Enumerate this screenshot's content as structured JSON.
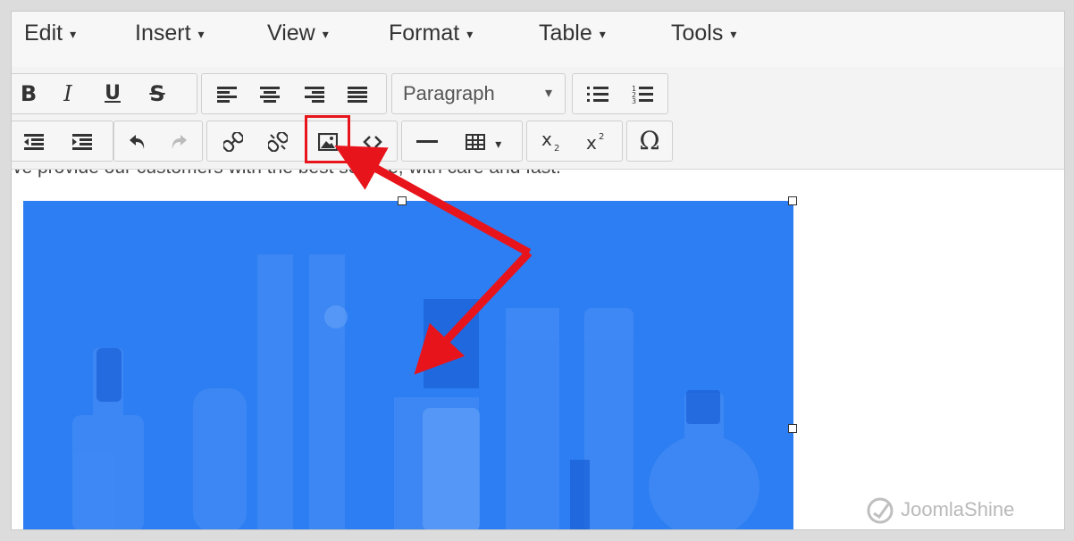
{
  "menubar": {
    "items": [
      {
        "label": "Edit"
      },
      {
        "label": "Insert"
      },
      {
        "label": "View"
      },
      {
        "label": "Format"
      },
      {
        "label": "Table"
      },
      {
        "label": "Tools"
      }
    ],
    "caret": "▾"
  },
  "toolbar": {
    "row1": {
      "bold": "B",
      "italic": "I",
      "underline": "U",
      "strikethrough": "S",
      "block_format": "Paragraph",
      "block_caret": "▾"
    },
    "row2": {
      "table_caret": "▾",
      "special_char": "Ω"
    },
    "icons": [
      "bold-icon",
      "italic-icon",
      "underline-icon",
      "strikethrough-icon",
      "align-left-icon",
      "align-center-icon",
      "align-right-icon",
      "align-justify-icon",
      "bullet-list-icon",
      "numbered-list-icon",
      "outdent-icon",
      "indent-icon",
      "undo-icon",
      "redo-icon",
      "link-icon",
      "unlink-icon",
      "insert-image-icon",
      "source-code-icon",
      "horizontal-rule-icon",
      "table-icon",
      "subscript-icon",
      "superscript-icon",
      "special-character-icon"
    ]
  },
  "content": {
    "body_text": "We provide our customers with the best service, with care and fast."
  },
  "watermark": "JoomlaShine",
  "colors": {
    "image_blue": "#2d7ef2",
    "highlight_red": "#e8141c",
    "toolbar_bg": "#f3f3f3"
  }
}
